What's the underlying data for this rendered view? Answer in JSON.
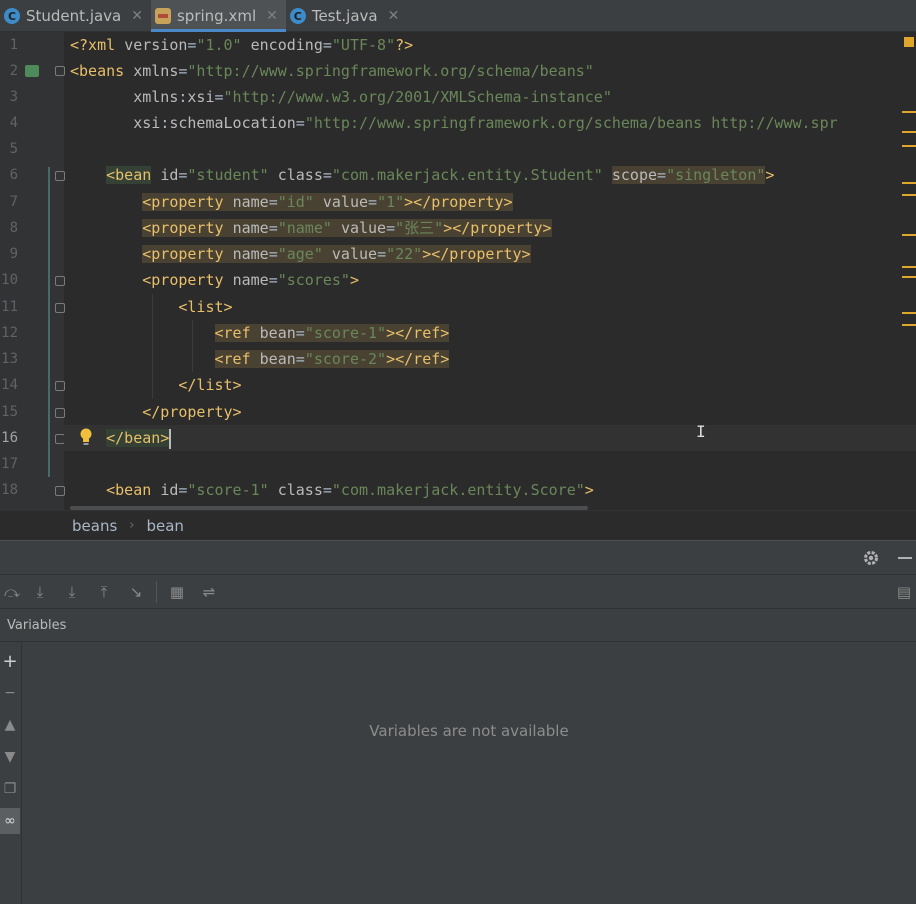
{
  "tabs": [
    {
      "label": "Student.java",
      "icon": "java-class-icon",
      "active": false
    },
    {
      "label": "spring.xml",
      "icon": "xml-file-icon",
      "active": true
    },
    {
      "label": "Test.java",
      "icon": "java-class-icon",
      "active": false
    }
  ],
  "tab_class_glyph": "C",
  "close_glyph": "✕",
  "line_numbers": [
    "1",
    "2",
    "3",
    "4",
    "5",
    "6",
    "7",
    "8",
    "9",
    "10",
    "11",
    "12",
    "13",
    "14",
    "15",
    "16",
    "17",
    "18"
  ],
  "breadcrumb": {
    "items": [
      "beans",
      "bean"
    ],
    "separator": "›"
  },
  "debug": {
    "variables_title": "Variables",
    "empty_message": "Variables are not available"
  },
  "colors": {
    "accent": "#4a88c7",
    "tag": "#e8bf6a",
    "value": "#6a8759",
    "attribute": "#bababa"
  }
}
